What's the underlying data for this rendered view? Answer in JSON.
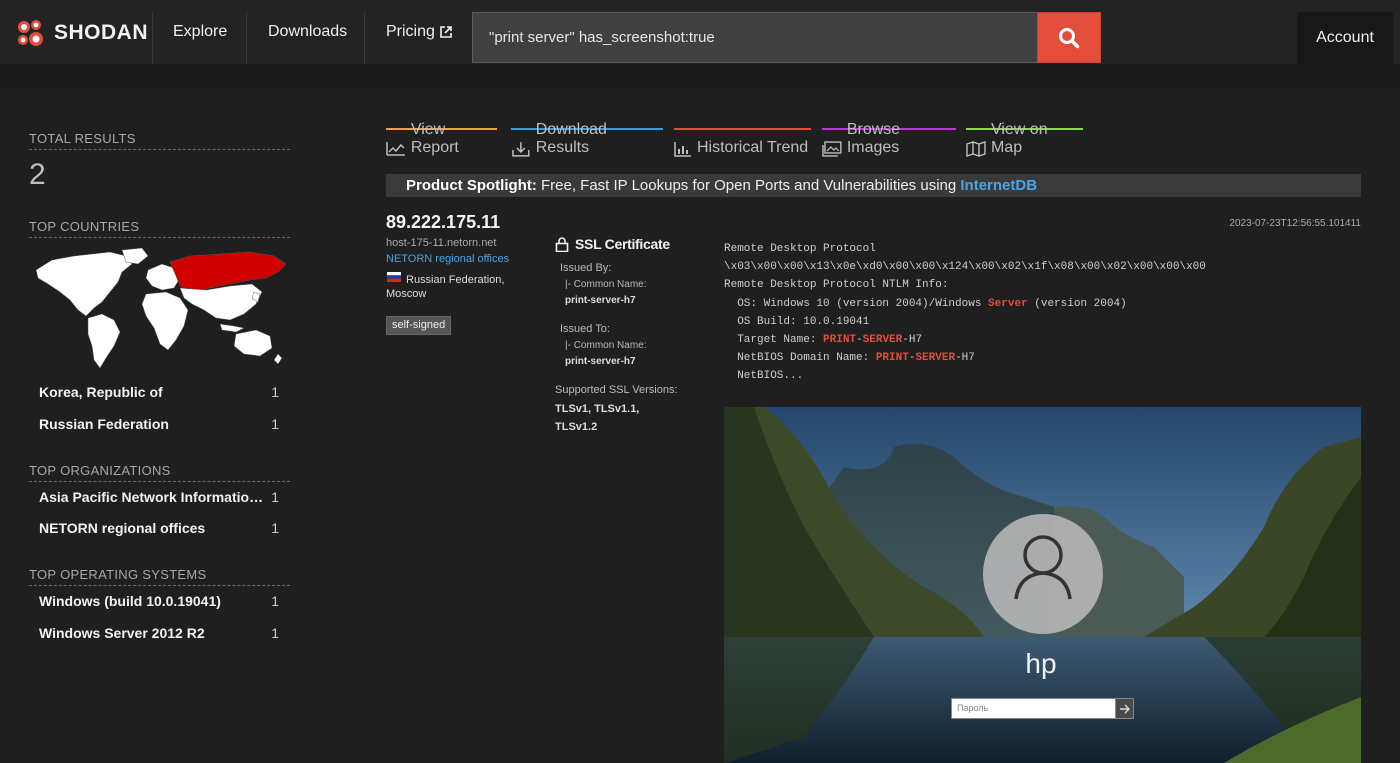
{
  "nav": {
    "brand": "SHODAN",
    "items": [
      "Explore",
      "Downloads",
      "Pricing"
    ],
    "search_value": "\"print server\" has_screenshot:true",
    "account": "Account"
  },
  "sidebar": {
    "total_label": "TOTAL RESULTS",
    "total": "2",
    "countries_label": "TOP COUNTRIES",
    "countries": [
      {
        "name": "Korea, Republic of",
        "count": "1"
      },
      {
        "name": "Russian Federation",
        "count": "1"
      }
    ],
    "orgs_label": "TOP ORGANIZATIONS",
    "orgs": [
      {
        "name": "Asia Pacific Network Information Centre",
        "count": "1"
      },
      {
        "name": "NETORN regional offices",
        "count": "1"
      }
    ],
    "os_label": "TOP OPERATING SYSTEMS",
    "os": [
      {
        "name": "Windows (build 10.0.19041)",
        "count": "1"
      },
      {
        "name": "Windows Server 2012 R2",
        "count": "1"
      }
    ]
  },
  "tabs": [
    {
      "label": "View Report",
      "color": "#e8a34a"
    },
    {
      "label": "Download Results",
      "color": "#3a9bd9"
    },
    {
      "label": "Historical Trend",
      "color": "#e24e3b"
    },
    {
      "label": "Browse Images",
      "color": "#b93ad9"
    },
    {
      "label": "View on Map",
      "color": "#8bd94a"
    }
  ],
  "spotlight": {
    "label": "Product Spotlight:",
    "text": "Free, Fast IP Lookups for Open Ports and Vulnerabilities using",
    "link": "InternetDB"
  },
  "result": {
    "ip": "89.222.175.11",
    "hostname": "host-175-11.netorn.net",
    "org": "NETORN regional offices",
    "location": "Russian Federation, Moscow",
    "tag": "self-signed",
    "timestamp": "2023-07-23T12:56:55.101411",
    "ssl": {
      "title": "SSL Certificate",
      "issued_by": "Issued By:",
      "issued_to": "Issued To:",
      "cn_label": "|- Common Name:",
      "by_cn": "print-server-h7",
      "to_cn": "print-server-h7",
      "versions_label": "Supported SSL Versions:",
      "versions": "TLSv1, TLSv1.1, TLSv1.2"
    },
    "banner": {
      "l1": "Remote Desktop Protocol",
      "l2": "\\x03\\x00\\x00\\x13\\x0e\\xd0\\x00\\x00\\x124\\x00\\x02\\x1f\\x08\\x00\\x02\\x00\\x00\\x00",
      "l3": "Remote Desktop Protocol NTLM Info:",
      "l4a": "  OS: Windows 10 (version 2004)/Windows ",
      "l4b": "Server",
      "l4c": " (version 2004)",
      "l5": "  OS Build: 10.0.19041",
      "l6a": "  Target Name: ",
      "l6b": "PRINT",
      "l6c": "-",
      "l6d": "SERVER",
      "l6e": "-H7",
      "l7a": "  NetBIOS Domain Name: ",
      "l7b": "PRINT",
      "l7c": "-",
      "l7d": "SERVER",
      "l7e": "-H7",
      "l8": "  NetBIOS..."
    },
    "screenshot": {
      "username": "hp",
      "password_placeholder": "Пароль"
    }
  }
}
